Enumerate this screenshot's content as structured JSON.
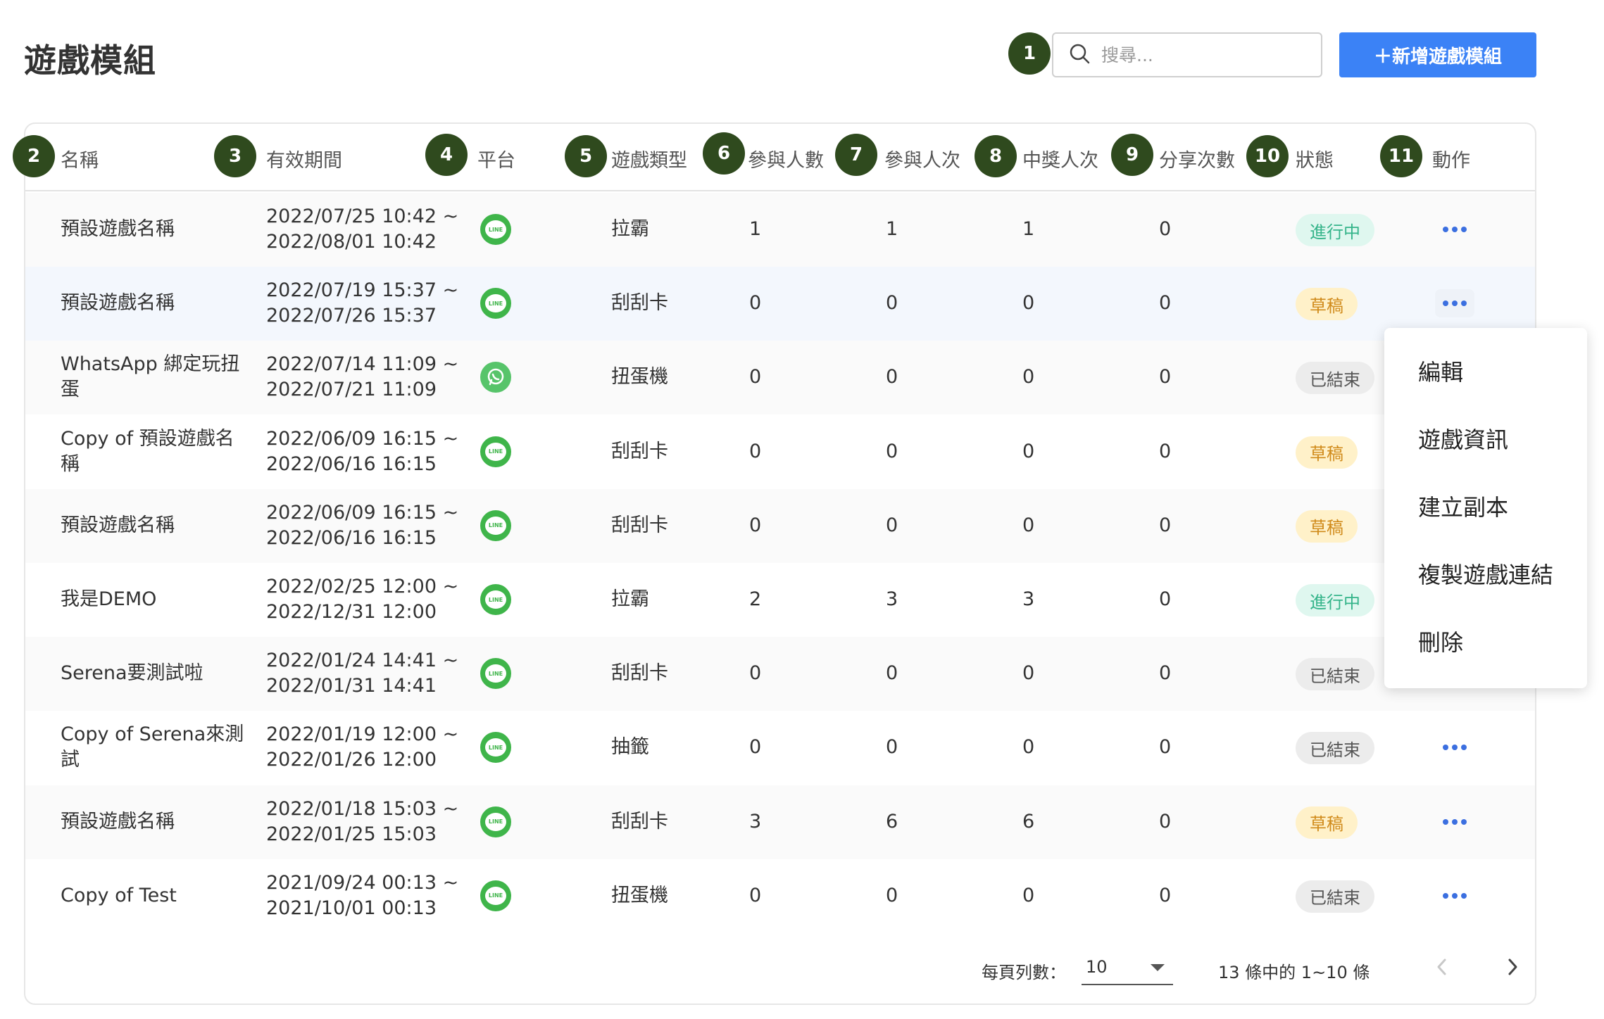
{
  "page": {
    "title": "遊戲模組"
  },
  "search": {
    "placeholder": "搜尋..."
  },
  "add_button": {
    "label": "＋新增遊戲模組"
  },
  "annotation_badges": [
    "1",
    "2",
    "3",
    "4",
    "5",
    "6",
    "7",
    "8",
    "9",
    "10",
    "11"
  ],
  "columns": {
    "name": "名稱",
    "period": "有效期間",
    "platform": "平台",
    "game_type": "遊戲類型",
    "participants": "參與人數",
    "participations": "參與人次",
    "winners": "中獎人次",
    "shares": "分享次數",
    "status": "狀態",
    "actions": "動作"
  },
  "rows": [
    {
      "name_line1": "預設遊戲名稱",
      "name_line2": "",
      "period_start": "2022/07/25 10:42 ~",
      "period_end": "2022/08/01 10:42",
      "platform": "line-icon",
      "game_type": "拉霸",
      "participants": "1",
      "participations": "1",
      "winners": "1",
      "shares": "0",
      "status": "進行中",
      "status_type": "active"
    },
    {
      "name_line1": "預設遊戲名稱",
      "name_line2": "",
      "period_start": "2022/07/19 15:37 ~",
      "period_end": "2022/07/26 15:37",
      "platform": "line-icon",
      "game_type": "刮刮卡",
      "participants": "0",
      "participations": "0",
      "winners": "0",
      "shares": "0",
      "status": "草稿",
      "status_type": "draft"
    },
    {
      "name_line1": "WhatsApp 綁定玩扭",
      "name_line2": "蛋",
      "period_start": "2022/07/14 11:09 ~",
      "period_end": "2022/07/21 11:09",
      "platform": "whatsapp-icon",
      "game_type": "扭蛋機",
      "participants": "0",
      "participations": "0",
      "winners": "0",
      "shares": "0",
      "status": "已結束",
      "status_type": "ended"
    },
    {
      "name_line1": "Copy of 預設遊戲名",
      "name_line2": "稱",
      "period_start": "2022/06/09 16:15 ~",
      "period_end": "2022/06/16 16:15",
      "platform": "line-icon",
      "game_type": "刮刮卡",
      "participants": "0",
      "participations": "0",
      "winners": "0",
      "shares": "0",
      "status": "草稿",
      "status_type": "draft"
    },
    {
      "name_line1": "預設遊戲名稱",
      "name_line2": "",
      "period_start": "2022/06/09 16:15 ~",
      "period_end": "2022/06/16 16:15",
      "platform": "line-icon",
      "game_type": "刮刮卡",
      "participants": "0",
      "participations": "0",
      "winners": "0",
      "shares": "0",
      "status": "草稿",
      "status_type": "draft"
    },
    {
      "name_line1": "我是DEMO",
      "name_line2": "",
      "period_start": "2022/02/25 12:00 ~",
      "period_end": "2022/12/31 12:00",
      "platform": "line-icon",
      "game_type": "拉霸",
      "participants": "2",
      "participations": "3",
      "winners": "3",
      "shares": "0",
      "status": "進行中",
      "status_type": "active"
    },
    {
      "name_line1": "Serena要測試啦",
      "name_line2": "",
      "period_start": "2022/01/24 14:41 ~",
      "period_end": "2022/01/31 14:41",
      "platform": "line-icon",
      "game_type": "刮刮卡",
      "participants": "0",
      "participations": "0",
      "winners": "0",
      "shares": "0",
      "status": "已結束",
      "status_type": "ended"
    },
    {
      "name_line1": "Copy of Serena來測",
      "name_line2": "試",
      "period_start": "2022/01/19 12:00 ~",
      "period_end": "2022/01/26 12:00",
      "platform": "line-icon",
      "game_type": "抽籤",
      "participants": "0",
      "participations": "0",
      "winners": "0",
      "shares": "0",
      "status": "已結束",
      "status_type": "ended"
    },
    {
      "name_line1": "預設遊戲名稱",
      "name_line2": "",
      "period_start": "2022/01/18 15:03 ~",
      "period_end": "2022/01/25 15:03",
      "platform": "line-icon",
      "game_type": "刮刮卡",
      "participants": "3",
      "participations": "6",
      "winners": "6",
      "shares": "0",
      "status": "草稿",
      "status_type": "draft"
    },
    {
      "name_line1": "Copy of Test",
      "name_line2": "",
      "period_start": "2021/09/24 00:13 ~",
      "period_end": "2021/10/01 00:13",
      "platform": "line-icon",
      "game_type": "扭蛋機",
      "participants": "0",
      "participations": "0",
      "winners": "0",
      "shares": "0",
      "status": "已結束",
      "status_type": "ended"
    }
  ],
  "line_icon_text": "LINE",
  "action_menu": {
    "items": [
      "編輯",
      "遊戲資訊",
      "建立副本",
      "複製遊戲連結",
      "刪除"
    ]
  },
  "pagination": {
    "rows_per_page_label": "每頁列數：",
    "rows_per_page_value": "10",
    "range_text": "13 條中的 1~10 條"
  },
  "colors": {
    "accent": "#3b82f6",
    "badge": "#2f4a1e",
    "line_green": "#3fb54a",
    "status_active_text": "#35b48a",
    "status_draft_text": "#d08a1a"
  }
}
